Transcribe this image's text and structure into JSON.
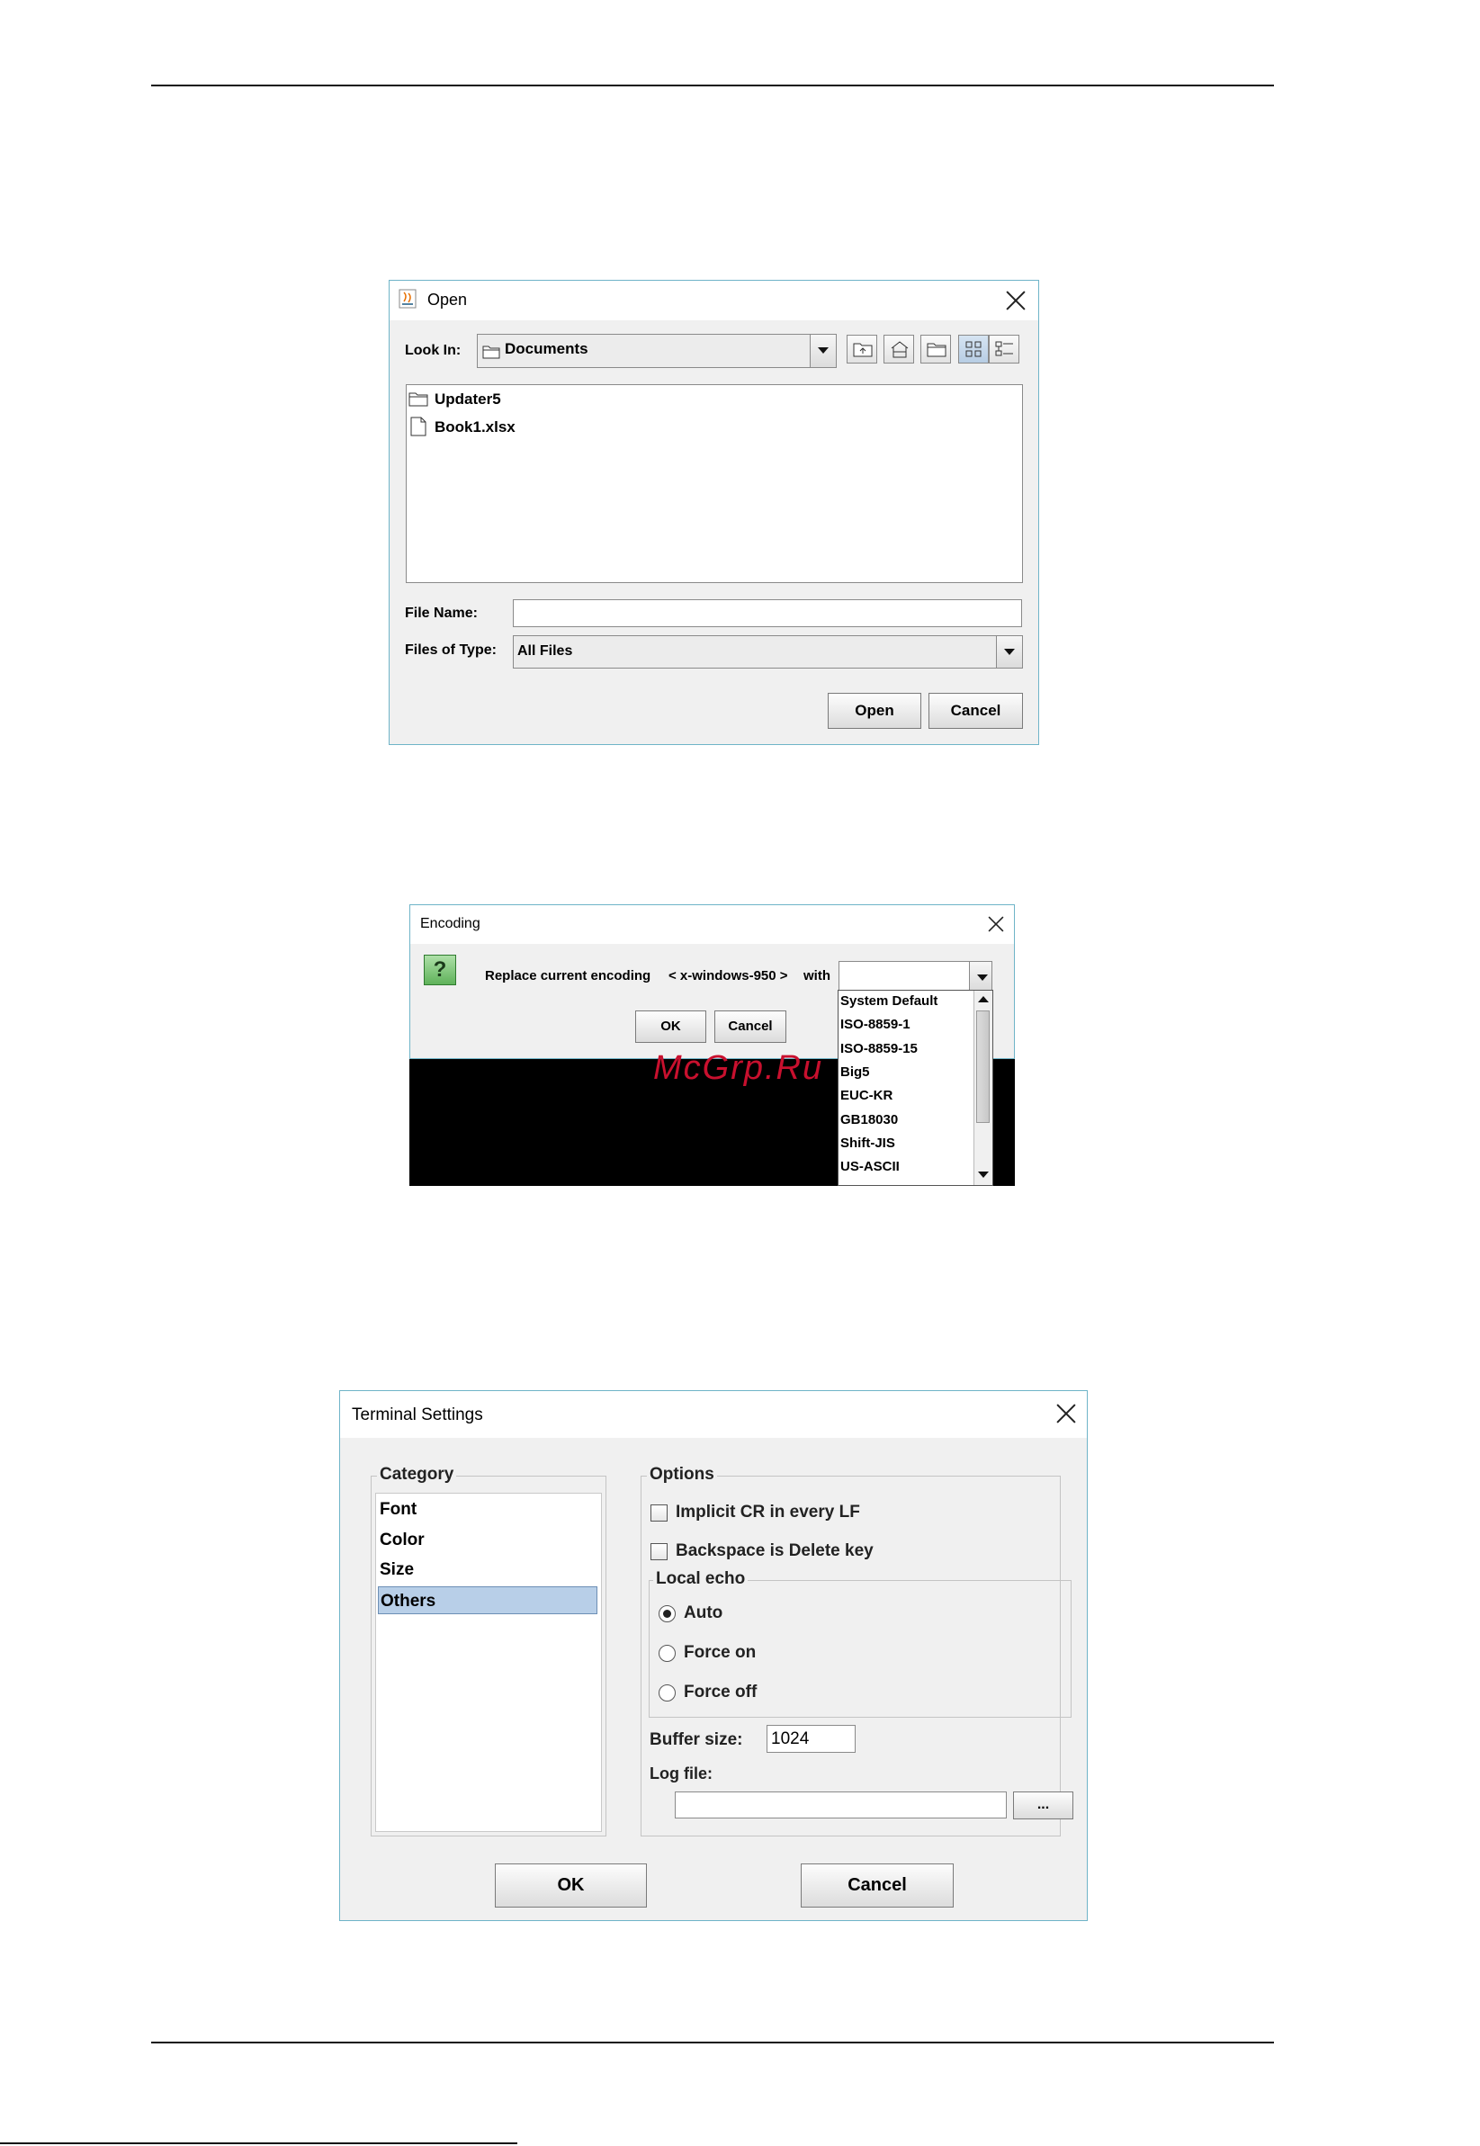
{
  "open_dialog": {
    "title": "Open",
    "look_in_label": "Look In:",
    "look_in_value": "Documents",
    "toolbar_icons": [
      "up-folder-icon",
      "home-icon",
      "new-folder-icon",
      "list-view-icon",
      "details-view-icon"
    ],
    "files": [
      {
        "name": "Updater5",
        "icon": "folder-icon"
      },
      {
        "name": "Book1.xlsx",
        "icon": "file-icon"
      }
    ],
    "file_name_label": "File Name:",
    "file_name_value": "",
    "files_of_type_label": "Files of Type:",
    "files_of_type_value": "All Files",
    "open_button": "Open",
    "cancel_button": "Cancel"
  },
  "encoding_dialog": {
    "title": "Encoding",
    "question_icon": "?",
    "message_prefix": "Replace current encoding",
    "current_encoding": "< x-windows-950 >",
    "message_suffix": "with",
    "selected_value": "",
    "options": [
      "System Default",
      "ISO-8859-1",
      "ISO-8859-15",
      "Big5",
      "EUC-KR",
      "GB18030",
      "Shift-JIS",
      "US-ASCII"
    ],
    "ok_button": "OK",
    "cancel_button": "Cancel",
    "watermark": "McGrp.Ru"
  },
  "terminal_settings": {
    "title": "Terminal Settings",
    "category_label": "Category",
    "categories": [
      "Font",
      "Color",
      "Size",
      "Others"
    ],
    "selected_category": "Others",
    "options_label": "Options",
    "implicit_cr_label": "Implicit CR in every LF",
    "implicit_cr_checked": false,
    "backspace_label": "Backspace is Delete key",
    "backspace_checked": false,
    "local_echo_label": "Local echo",
    "local_echo_options": [
      "Auto",
      "Force on",
      "Force off"
    ],
    "local_echo_selected": "Auto",
    "buffer_size_label": "Buffer size:",
    "buffer_size_value": "1024",
    "log_file_label": "Log file:",
    "log_file_value": "",
    "browse_button": "...",
    "ok_button": "OK",
    "cancel_button": "Cancel"
  },
  "colors": {
    "dialog_border": "#6fb4c8",
    "dialog_bg": "#f0f0f0",
    "selection_bg": "#b8cfe8",
    "watermark_red": "#c8102e"
  }
}
